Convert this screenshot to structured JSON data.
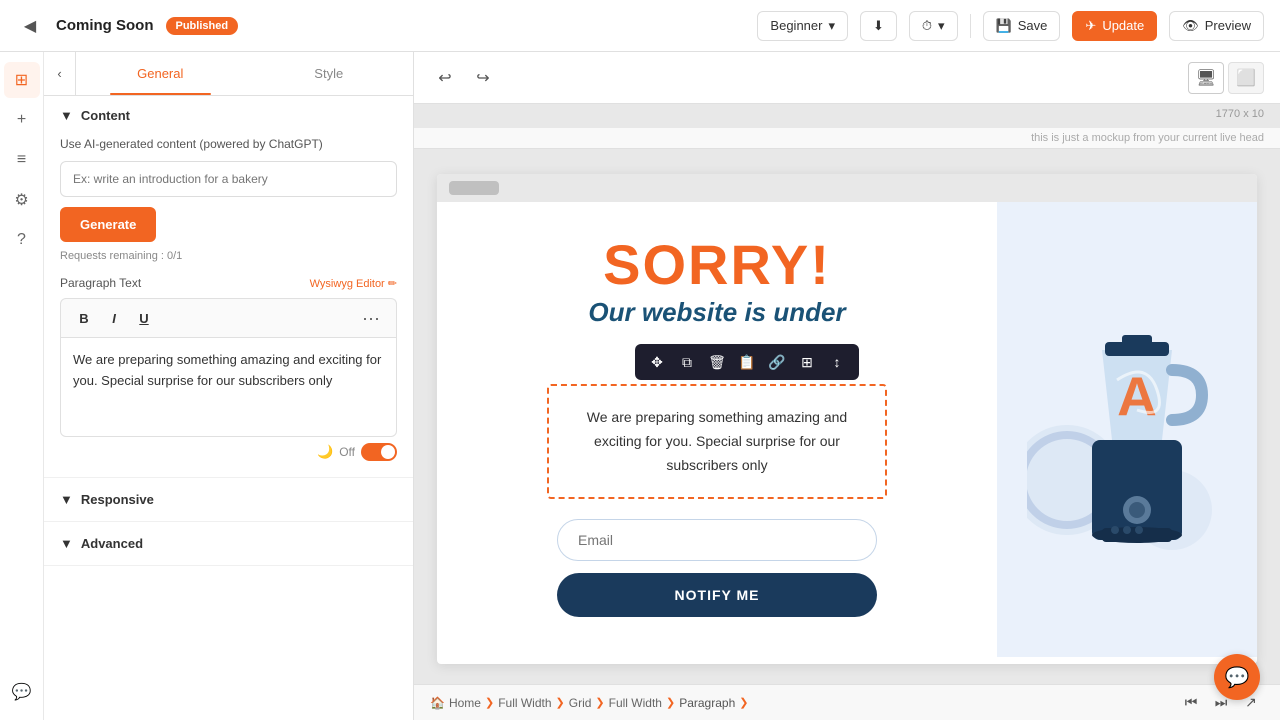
{
  "topbar": {
    "back_icon": "◀",
    "title": "Coming Soon",
    "badge": "Published",
    "level_label": "Beginner",
    "chevron": "▾",
    "download_icon": "⬇",
    "history_icon": "⏱",
    "save_label": "Save",
    "update_label": "Update",
    "preview_label": "Preview"
  },
  "icon_bar": {
    "items": [
      {
        "name": "layers-icon",
        "icon": "⊞",
        "active": true
      },
      {
        "name": "add-icon",
        "icon": "+",
        "active": false
      },
      {
        "name": "list-icon",
        "icon": "≡",
        "active": false
      },
      {
        "name": "settings-icon",
        "icon": "⚙",
        "active": false
      },
      {
        "name": "help-icon",
        "icon": "?",
        "active": false
      },
      {
        "name": "chat-icon",
        "icon": "💬",
        "active": false
      }
    ]
  },
  "panel": {
    "back_icon": "‹",
    "tab_general": "General",
    "tab_style": "Style",
    "section_content": "Content",
    "ai_label": "Use AI-generated content (powered by ChatGPT)",
    "ai_placeholder": "Ex: write an introduction for a bakery",
    "generate_label": "Generate",
    "requests_remaining": "Requests remaining : 0/1",
    "paragraph_label": "Paragraph Text",
    "wysiwyg_label": "Wysiwyg Editor ✏",
    "text_content": "We are preparing something amazing and exciting for you. Special surprise for our subscribers only",
    "toggle_label": "Off",
    "section_responsive": "Responsive",
    "section_advanced": "Advanced"
  },
  "canvas": {
    "undo_icon": "↩",
    "redo_icon": "↪",
    "desktop_icon": "🖥",
    "tablet_icon": "⬜",
    "dimensions": "1770 x 10",
    "mockup_text": "this is just a mockup from your current live head"
  },
  "page": {
    "sorry_text": "SORRY!",
    "subtitle": "Our website is under",
    "paragraph": "We are preparing something amazing and exciting for you. Special surprise for our subscribers only",
    "email_placeholder": "Email",
    "notify_label": "NOTIFY ME"
  },
  "breadcrumb": {
    "items": [
      {
        "label": "Home",
        "icon": "🏠"
      },
      {
        "label": "Full Width"
      },
      {
        "label": "Grid"
      },
      {
        "label": "Full Width"
      },
      {
        "label": "Paragraph"
      }
    ]
  },
  "colors": {
    "orange": "#f26522",
    "dark_blue": "#1a3a5c",
    "light_blue": "#eaf1fb"
  }
}
